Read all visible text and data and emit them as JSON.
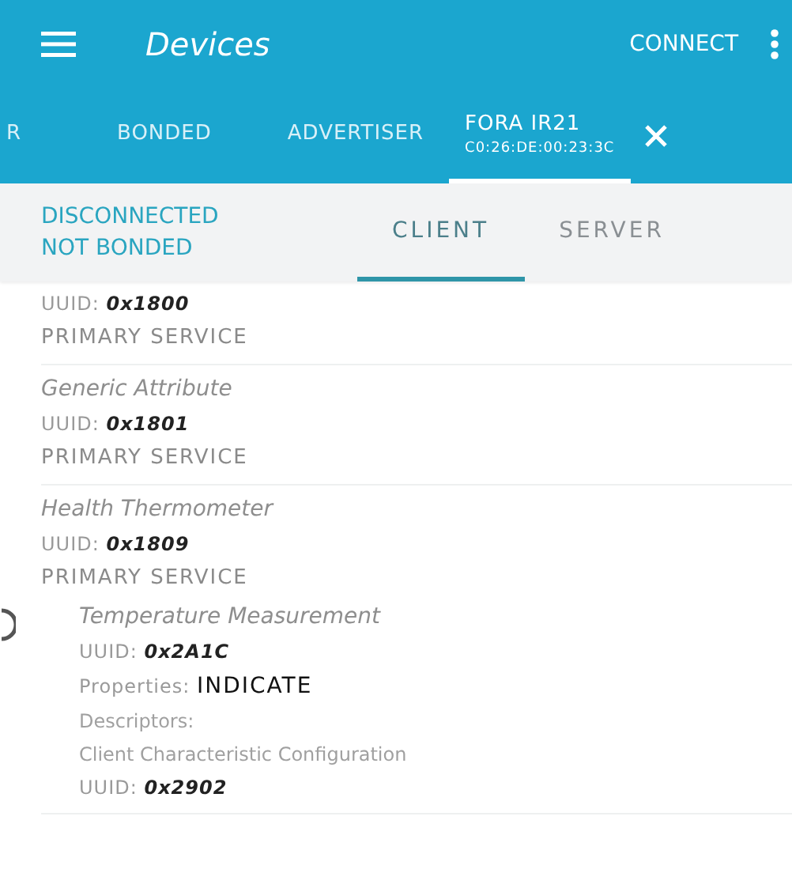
{
  "app_bar": {
    "title": "Devices",
    "action": "CONNECT"
  },
  "tabs": [
    {
      "label": "R",
      "selected": false
    },
    {
      "label": "BONDED",
      "selected": false
    },
    {
      "label": "ADVERTISER",
      "selected": false
    },
    {
      "label": "FORA IR21",
      "sublabel": "C0:26:DE:00:23:3C",
      "selected": true,
      "closable": true
    }
  ],
  "connection": {
    "state": "DISCONNECTED",
    "bond": "NOT BONDED"
  },
  "subtabs": [
    {
      "label": "CLIENT",
      "selected": true
    },
    {
      "label": "SERVER",
      "selected": false
    }
  ],
  "services": [
    {
      "uuid": {
        "label": "UUID:",
        "value": "0x1800"
      },
      "type": "PRIMARY SERVICE"
    },
    {
      "name": "Generic Attribute",
      "uuid": {
        "label": "UUID:",
        "value": "0x1801"
      },
      "type": "PRIMARY SERVICE"
    },
    {
      "name": "Health Thermometer",
      "uuid": {
        "label": "UUID:",
        "value": "0x1809"
      },
      "type": "PRIMARY SERVICE",
      "characteristics": [
        {
          "name": "Temperature Measurement",
          "uuid": {
            "label": "UUID:",
            "value": "0x2A1C"
          },
          "properties": {
            "label": "Properties:",
            "value": "INDICATE"
          },
          "descriptors_label": "Descriptors:",
          "descriptors": [
            {
              "name": "Client Characteristic Configuration",
              "uuid": {
                "label": "UUID:",
                "value": "0x2902"
              }
            }
          ]
        }
      ]
    }
  ]
}
